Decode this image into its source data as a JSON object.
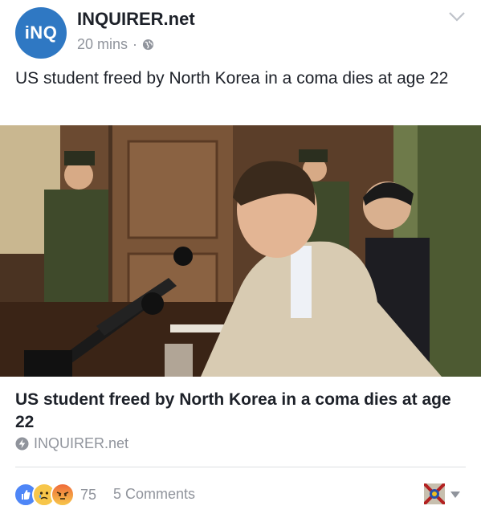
{
  "post": {
    "page_logo_text": "iNQ",
    "page_name": "INQUIRER.net",
    "time": "20 mins",
    "separator": "·",
    "privacy_icon": "globe-icon",
    "options_icon": "chevron-down-icon",
    "text": "US student freed by North Korea in a coma dies at age 22"
  },
  "link": {
    "title": "US student freed by North Korea in a coma dies at age 22",
    "source": "INQUIRER.net",
    "source_icon": "instant-article-bolt-icon"
  },
  "footer": {
    "reaction_icons": [
      "like-icon",
      "sad-icon",
      "angry-icon"
    ],
    "reaction_count": "75",
    "comments": "5 Comments",
    "actor_icon": "avatar-icon",
    "menu_icon": "caret-down-icon"
  },
  "colors": {
    "logo_blue": "#2f78c3",
    "like_blue": "#4e86f7",
    "reaction_yellow": "#f7c64a",
    "angry_orange": "#ef6b3a",
    "meta_gray": "#90949c"
  }
}
